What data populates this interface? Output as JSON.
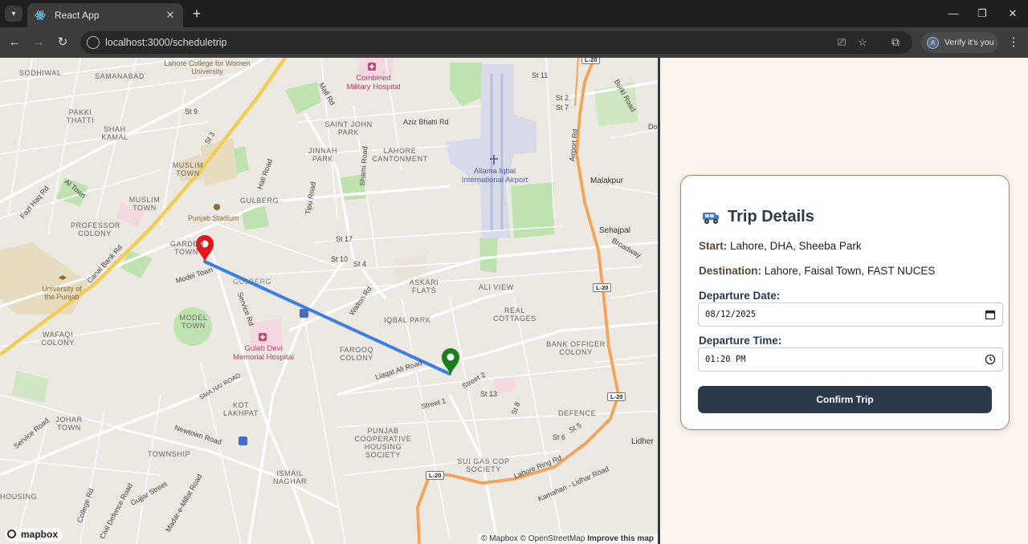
{
  "browser": {
    "tab_title": "React App",
    "new_tab_symbol": "+",
    "url": "localhost:3000/scheduletrip",
    "profile_text": "Verify it's you",
    "profile_initial": "A"
  },
  "map": {
    "area_labels": [
      "SODHIWAL",
      "SAMANABAD",
      "PAKKI THATTI",
      "SHAH KAMAL",
      "MUSLIM TOWN",
      "MUSLIM TOWN",
      "PROFESSOR COLONY",
      "GARDEN TOWN",
      "GULBERG",
      "GULBERG",
      "SAINT JOHN PARK",
      "JINNAH PARK",
      "LAHORE CANTONMENT",
      "ASKARI FLATS",
      "ALI VIEW",
      "IQBAL PARK",
      "REAL COTTAGES",
      "MODEL TOWN",
      "WAFAQI COLONY",
      "FAROOQ COLONY",
      "BANK OFFICER COLONY",
      "KOT LAKHPAT",
      "JOHAR TOWN",
      "TOWNSHIP",
      "PUNJAB COOPERATIVE HOUSING SOCIETY",
      "SUI GAS COP SOCIETY",
      "DEFENCE",
      "ISMAIL NAGHAR",
      "HOUSING"
    ],
    "poi_labels": [
      "Lahore College for Women University",
      "Combined Military Hospital",
      "Allama Iqbal International Airport",
      "Punjab Stadium",
      "University of the Punjab",
      "Gulab Devi Memorial Hospital",
      "Malakpur",
      "Sehajpal",
      "Lidher"
    ],
    "road_labels": [
      "Mall Rd",
      "Aziz Bhatti Rd",
      "Burki Road",
      "Airport Rd",
      "Canal Bank Rd",
      "Model Town",
      "Service Rd",
      "Walton Rd",
      "Liaqat Ali Road",
      "Street 1",
      "Street 2",
      "Newtown Road",
      "SMA HAI ROAD",
      "Lahore Ring Rd",
      "Kamahan - Lidhar Road",
      "Broadway",
      "Hali Road",
      "Tipu Road",
      "Shami Road",
      "Fazl Haq Rd",
      "Al Town",
      "College Rd",
      "Gujjar Street",
      "Civil Defence Road",
      "Madar-e-Millat Road",
      "Service Road",
      "St 9",
      "St 3",
      "St 11",
      "St 2",
      "St 7",
      "St 17",
      "St 10",
      "St 4",
      "St 13",
      "St 8",
      "St 6",
      "St 5",
      "Do"
    ],
    "highway_shield": "L-20",
    "logo_text": "mapbox",
    "attribution": "© Mapbox © OpenStreetMap",
    "improve_link": "Improve this map",
    "start_marker_color": "#e8141c",
    "end_marker_color": "#1a7f1a",
    "route_color": "#3b7fe6"
  },
  "trip": {
    "title": "Trip Details",
    "start_label": "Start:",
    "start_value": "Lahore, DHA, Sheeba Park",
    "destination_label": "Destination:",
    "destination_value": "Lahore, Faisal Town, FAST NUCES",
    "date_label": "Departure Date:",
    "date_value": "08/12/2025",
    "time_label": "Departure Time:",
    "time_value": "01:20 PM",
    "confirm_label": "Confirm Trip"
  }
}
